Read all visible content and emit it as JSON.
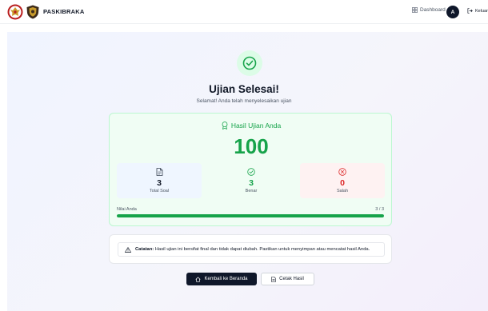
{
  "header": {
    "brand": "PASKIBRAKA",
    "nav_dashboard": "Dashboard",
    "avatar_initial": "A",
    "logout": "Keluar"
  },
  "result": {
    "title": "Ujian Selesai!",
    "subtitle": "Selamat! Anda telah menyelesaikan ujian",
    "card_title": "Hasil Ujian Anda",
    "score": "100",
    "stats": [
      {
        "value": "3",
        "label": "Total Soal",
        "icon": "document-icon"
      },
      {
        "value": "3",
        "label": "Benar",
        "icon": "check-circle-icon"
      },
      {
        "value": "0",
        "label": "Salah",
        "icon": "x-circle-icon"
      }
    ],
    "nilai_label": "Nilai Anda",
    "nilai_value": "3 / 3",
    "progress_fraction": 1.0
  },
  "notice": {
    "label": "Catatan:",
    "text": "Hasil ujian ini bersifat final dan tidak dapat diubah. Pastikan untuk menyimpan atau mencatat hasil Anda."
  },
  "actions": {
    "home": "Kembali ke Beranda",
    "print": "Cetak Hasil"
  },
  "colors": {
    "success": "#16a34a",
    "danger": "#dc2626",
    "primary_dark": "#0f172a"
  }
}
